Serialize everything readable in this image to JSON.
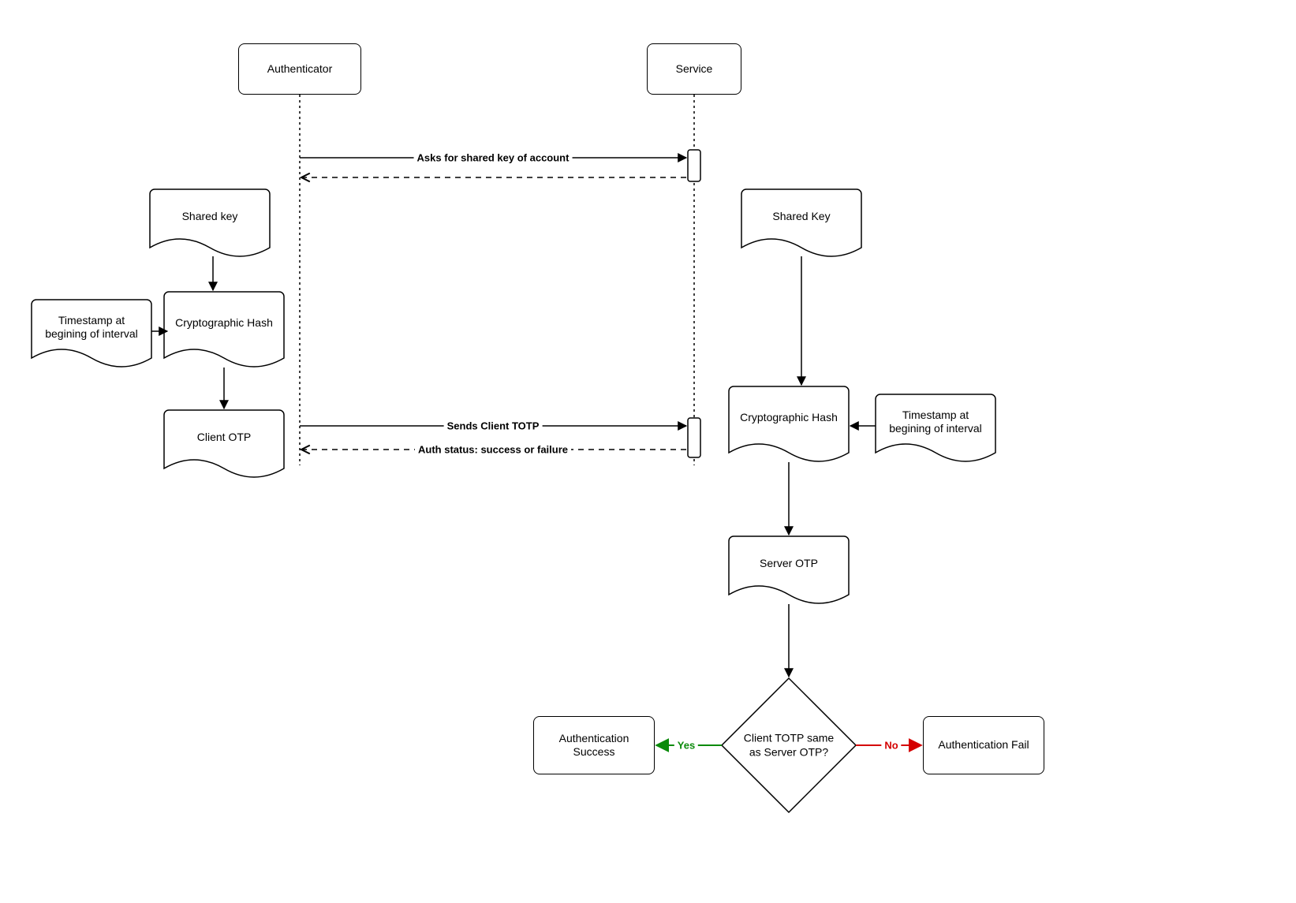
{
  "participants": {
    "authenticator": "Authenticator",
    "service": "Service"
  },
  "client": {
    "shared_key": "Shared key",
    "timestamp": "Timestamp at begining of interval",
    "hash": "Cryptographic Hash",
    "otp": "Client OTP"
  },
  "server": {
    "shared_key": "Shared Key",
    "timestamp": "Timestamp at begining of interval",
    "hash": "Cryptographic Hash",
    "otp": "Server OTP"
  },
  "messages": {
    "ask_key": "Asks for shared key of account",
    "send_totp": "Sends Client TOTP",
    "auth_status": "Auth status: success or failure"
  },
  "decision": {
    "question": "Client TOTP same as Server OTP?",
    "yes": "Yes",
    "no": "No"
  },
  "outcomes": {
    "success": "Authentication Success",
    "fail": "Authentication Fail"
  },
  "colors": {
    "yes": "#0a8a0a",
    "no": "#d40000"
  }
}
